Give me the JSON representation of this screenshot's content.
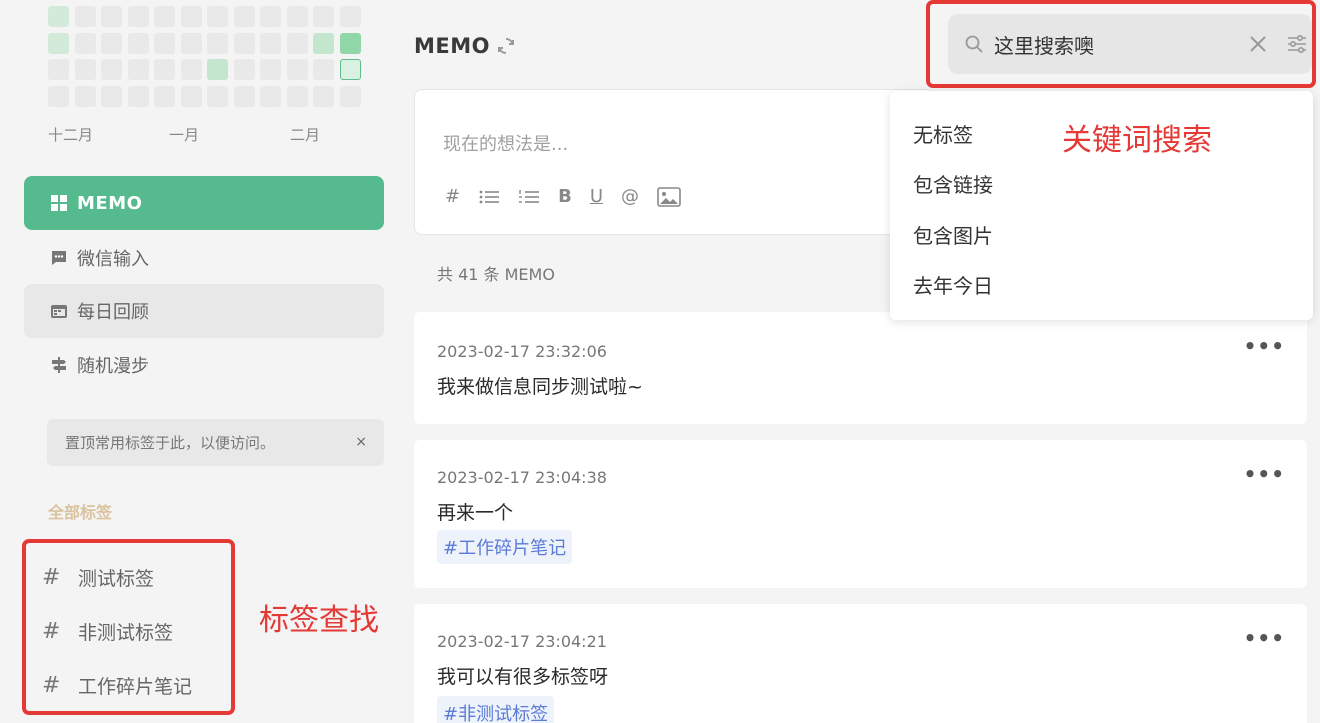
{
  "sidebar": {
    "months": [
      "十二月",
      "一月",
      "二月"
    ],
    "nav": [
      {
        "label": "MEMO",
        "icon": "grid-icon"
      },
      {
        "label": "微信输入",
        "icon": "chat-icon"
      },
      {
        "label": "每日回顾",
        "icon": "calendar-icon"
      },
      {
        "label": "随机漫步",
        "icon": "signpost-icon"
      }
    ],
    "pin_tip": "置顶常用标签于此，以便访问。",
    "pin_close": "×",
    "all_tags_title": "全部标签",
    "tags": [
      "测试标签",
      "非测试标签",
      "工作碎片笔记"
    ],
    "tag_hash": "#"
  },
  "annotations": {
    "tag_search": "标签查找",
    "keyword_search": "关键词搜索"
  },
  "header": {
    "title": "MEMO"
  },
  "search": {
    "value": "这里搜索噢"
  },
  "editor": {
    "placeholder": "现在的想法是...",
    "tools": [
      "#",
      "B",
      "U",
      "@"
    ]
  },
  "dropdown": {
    "items": [
      "无标签",
      "包含链接",
      "包含图片",
      "去年今日"
    ]
  },
  "memo_count": "共 41 条 MEMO",
  "memos": [
    {
      "time": "2023-02-17 23:32:06",
      "text": "我来做信息同步测试啦~",
      "tag": ""
    },
    {
      "time": "2023-02-17 23:04:38",
      "text": "再来一个",
      "tag": "#工作碎片笔记"
    },
    {
      "time": "2023-02-17 23:04:21",
      "text": "我可以有很多标签呀",
      "tag": "#非测试标签"
    }
  ],
  "more_label": "•••",
  "colors": {
    "accent": "#55bb8e",
    "annotation_red": "#e53935",
    "tag_text": "#5a7bd6",
    "tags_title": "#d9c39e"
  }
}
